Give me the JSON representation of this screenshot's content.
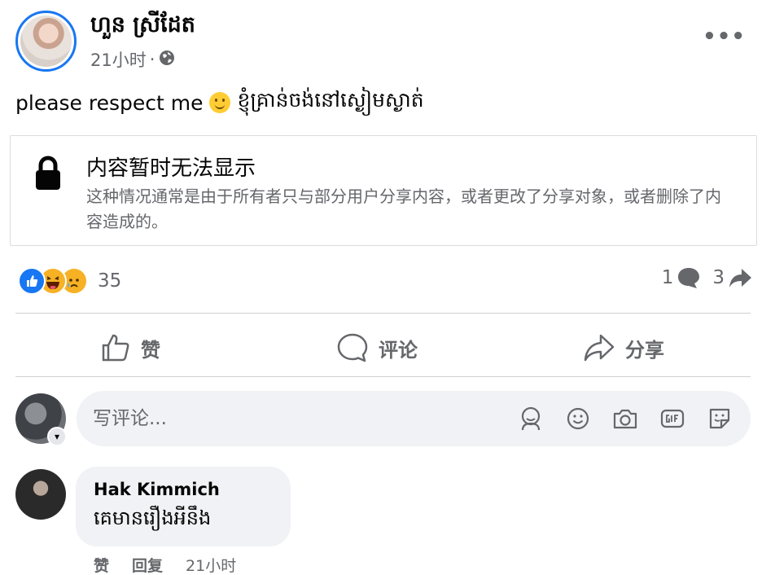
{
  "post": {
    "author": "ហួន ស្រីដែត",
    "time": "21小时",
    "separator": "·",
    "privacy_icon": "globe-icon",
    "more_icon": "more-dots-icon",
    "more_label": "•••",
    "text_en": "please respect me",
    "emoji": "slightly-smiling-face",
    "text_km": "ខ្ញុំគ្រាន់ចង់នៅស្ងៀមស្ងាត់"
  },
  "unavailable": {
    "icon": "lock-icon",
    "title": "内容暂时无法显示",
    "description": "这种情况通常是由于所有者只与部分用户分享内容，或者更改了分享对象，或者删除了内容造成的。"
  },
  "reactions": {
    "types": [
      "like",
      "haha",
      "sad"
    ],
    "count": "35",
    "comments_count": "1",
    "shares_count": "3"
  },
  "actions": {
    "like": "赞",
    "comment": "评论",
    "share": "分享"
  },
  "composer": {
    "placeholder": "写评论...",
    "icons": [
      "avatar-sticker-icon",
      "emoji-icon",
      "camera-icon",
      "gif-icon",
      "sticker-icon"
    ]
  },
  "comment": {
    "author": "Hak Kimmich",
    "text": "គេមានរឿងអីនឹង",
    "like_label": "赞",
    "reply_label": "回复",
    "time": "21小时"
  },
  "colors": {
    "brand": "#1877f2",
    "secondary_text": "#65676b",
    "bubble_bg": "#f0f2f5"
  }
}
